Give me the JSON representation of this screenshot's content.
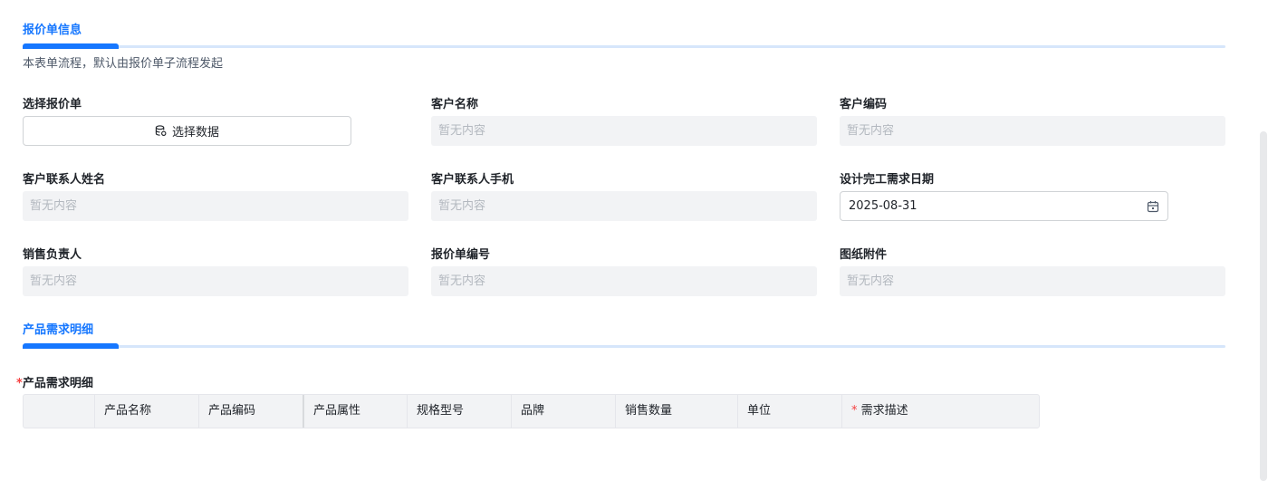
{
  "section1": {
    "title": "报价单信息",
    "subtitle": "本表单流程，默认由报价单子流程发起"
  },
  "fields": {
    "select_quote": {
      "label": "选择报价单",
      "button": "选择数据"
    },
    "customer_name": {
      "label": "客户名称",
      "value": "暂无内容"
    },
    "customer_code": {
      "label": "客户编码",
      "value": "暂无内容"
    },
    "contact_name": {
      "label": "客户联系人姓名",
      "value": "暂无内容"
    },
    "contact_phone": {
      "label": "客户联系人手机",
      "value": "暂无内容"
    },
    "design_date": {
      "label": "设计完工需求日期",
      "value": "2025-08-31"
    },
    "sales_owner": {
      "label": "销售负责人",
      "value": "暂无内容"
    },
    "quote_number": {
      "label": "报价单编号",
      "value": "暂无内容"
    },
    "drawing_attachment": {
      "label": "图纸附件",
      "value": "暂无内容"
    }
  },
  "section2": {
    "title": "产品需求明细",
    "table_label": "产品需求明细"
  },
  "table": {
    "columns": [
      "",
      "产品名称",
      "产品编码",
      "产品属性",
      "规格型号",
      "品牌",
      "销售数量",
      "单位",
      "需求描述"
    ]
  },
  "colors": {
    "accent": "#1677ff",
    "required": "#f53f3f",
    "readonly_bg": "#f2f3f5"
  }
}
